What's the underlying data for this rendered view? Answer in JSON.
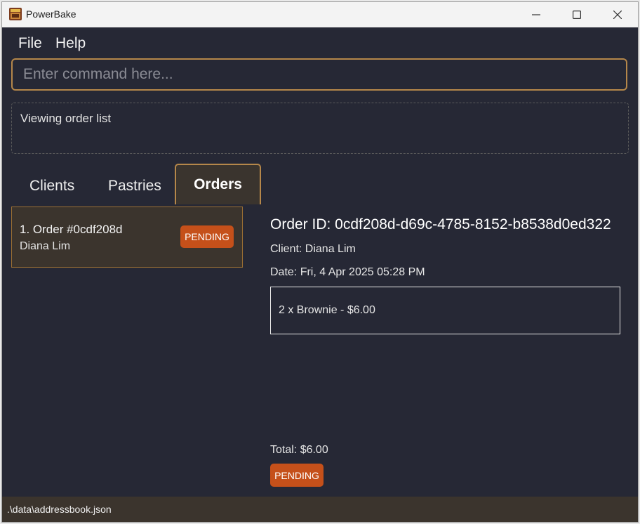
{
  "window": {
    "title": "PowerBake",
    "icon": "oven-icon"
  },
  "menu": {
    "file": "File",
    "help": "Help"
  },
  "command": {
    "placeholder": "Enter command here...",
    "value": ""
  },
  "result": {
    "message": "Viewing order list"
  },
  "tabs": {
    "items": [
      {
        "label": "Clients"
      },
      {
        "label": "Pastries"
      },
      {
        "label": "Orders"
      }
    ],
    "active": "Orders"
  },
  "order_list": {
    "items": [
      {
        "title": "1. Order #0cdf208d",
        "client": "Diana Lim",
        "status": "PENDING"
      }
    ]
  },
  "order_detail": {
    "id_line": "Order ID: 0cdf208d-d69c-4785-8152-b8538d0ed322",
    "client_line": "Client: Diana Lim",
    "date_line": "Date: Fri, 4 Apr 2025 05:28 PM",
    "items": [
      "2 x Brownie - $6.00"
    ],
    "total_line": "Total: $6.00",
    "status": "PENDING"
  },
  "statusbar": {
    "path": ".\\data\\addressbook.json"
  },
  "colors": {
    "background": "#262835",
    "accent": "#b5874a",
    "card": "#3b342d",
    "pending": "#c5501a"
  }
}
